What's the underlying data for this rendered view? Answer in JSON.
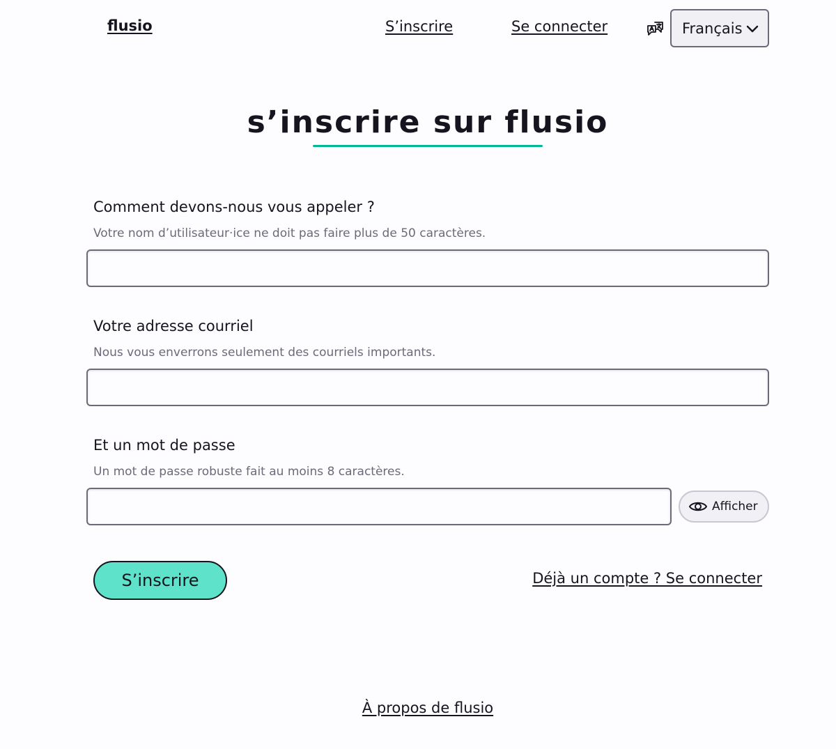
{
  "header": {
    "brand": "flusio",
    "nav": {
      "register_label": "S’inscrire",
      "login_label": "Se connecter"
    },
    "language": {
      "icon": "translate-icon",
      "selected": "Français",
      "chevron_icon": "chevron-down-icon"
    }
  },
  "main": {
    "title": "s’inscrire sur flusio",
    "accent_color": "#00b894",
    "fields": {
      "username": {
        "label": "Comment devons-nous vous appeler ?",
        "help": "Votre nom d’utilisateur·ice ne doit pas faire plus de 50 caractères.",
        "value": ""
      },
      "email": {
        "label": "Votre adresse courriel",
        "help": "Nous vous enverrons seulement des courriels importants.",
        "value": ""
      },
      "password": {
        "label": "Et un mot de passe",
        "help": "Un mot de passe robuste fait au moins 8 caractères.",
        "value": "",
        "show_label": "Afficher",
        "show_icon": "eye-icon"
      }
    },
    "submit_label": "S’inscrire",
    "submit_color": "#5ee2c9",
    "login_link": "Déjà un compte ? Se connecter"
  },
  "footer": {
    "about_link": "À propos de flusio"
  }
}
